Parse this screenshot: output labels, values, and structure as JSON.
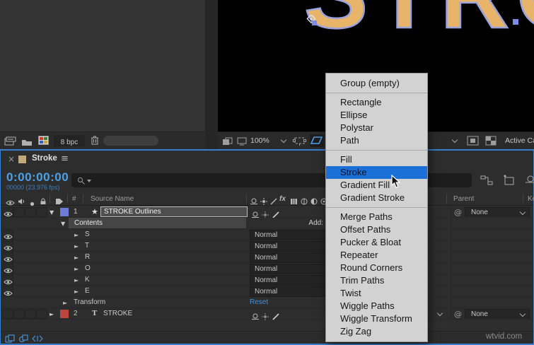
{
  "project_panel": {
    "bpc_button": "8 bpc"
  },
  "viewer": {
    "headline": "STROK",
    "zoom_value": "100%",
    "camera_value": "Active Ca"
  },
  "timeline": {
    "tab": {
      "close_glyph": "×",
      "title": "Stroke",
      "menu_glyph": "≡"
    },
    "timecode": "0:00:00:00",
    "frame_info": "00000 (23.976 fps)",
    "header": {
      "hash": "#",
      "source_name": "Source Name",
      "parent": "Parent",
      "key": "Ke"
    },
    "add_label": "Add:",
    "mode_value": "Normal",
    "layer1": {
      "index": "1",
      "icon_glyph": "★",
      "name": "STROKE Outlines",
      "parent_value": "None"
    },
    "contents_label": "Contents",
    "groups": [
      "S",
      "T",
      "R",
      "O",
      "K",
      "E"
    ],
    "transform_label": "Transform",
    "reset_label": "Reset",
    "layer2": {
      "index": "2",
      "icon_glyph": "T",
      "name": "STROKE",
      "parent_value": "None"
    },
    "expand_glyph": "▼",
    "collapse_glyph": "►",
    "pickwhip_glyph": "@"
  },
  "menu": {
    "items": [
      "Group (empty)",
      "Rectangle",
      "Ellipse",
      "Polystar",
      "Path",
      "Fill",
      "Stroke",
      "Gradient Fill",
      "Gradient Stroke",
      "Merge Paths",
      "Offset Paths",
      "Pucker & Bloat",
      "Repeater",
      "Round Corners",
      "Trim Paths",
      "Twist",
      "Wiggle Paths",
      "Wiggle Transform",
      "Zig Zag"
    ],
    "highlighted": "Stroke"
  },
  "colors": {
    "timecode_blue": "#4ba1e8",
    "reset_blue": "#3e94e0",
    "menu_highlight": "#1a70d6",
    "headline_fill": "#e7b46a",
    "headline_outline": "#9aa3de",
    "layer1_label": "#6d7cd9",
    "layer2_label": "#bc463e",
    "focus_border": "#3780cf"
  },
  "watermark": "wtvid.com"
}
